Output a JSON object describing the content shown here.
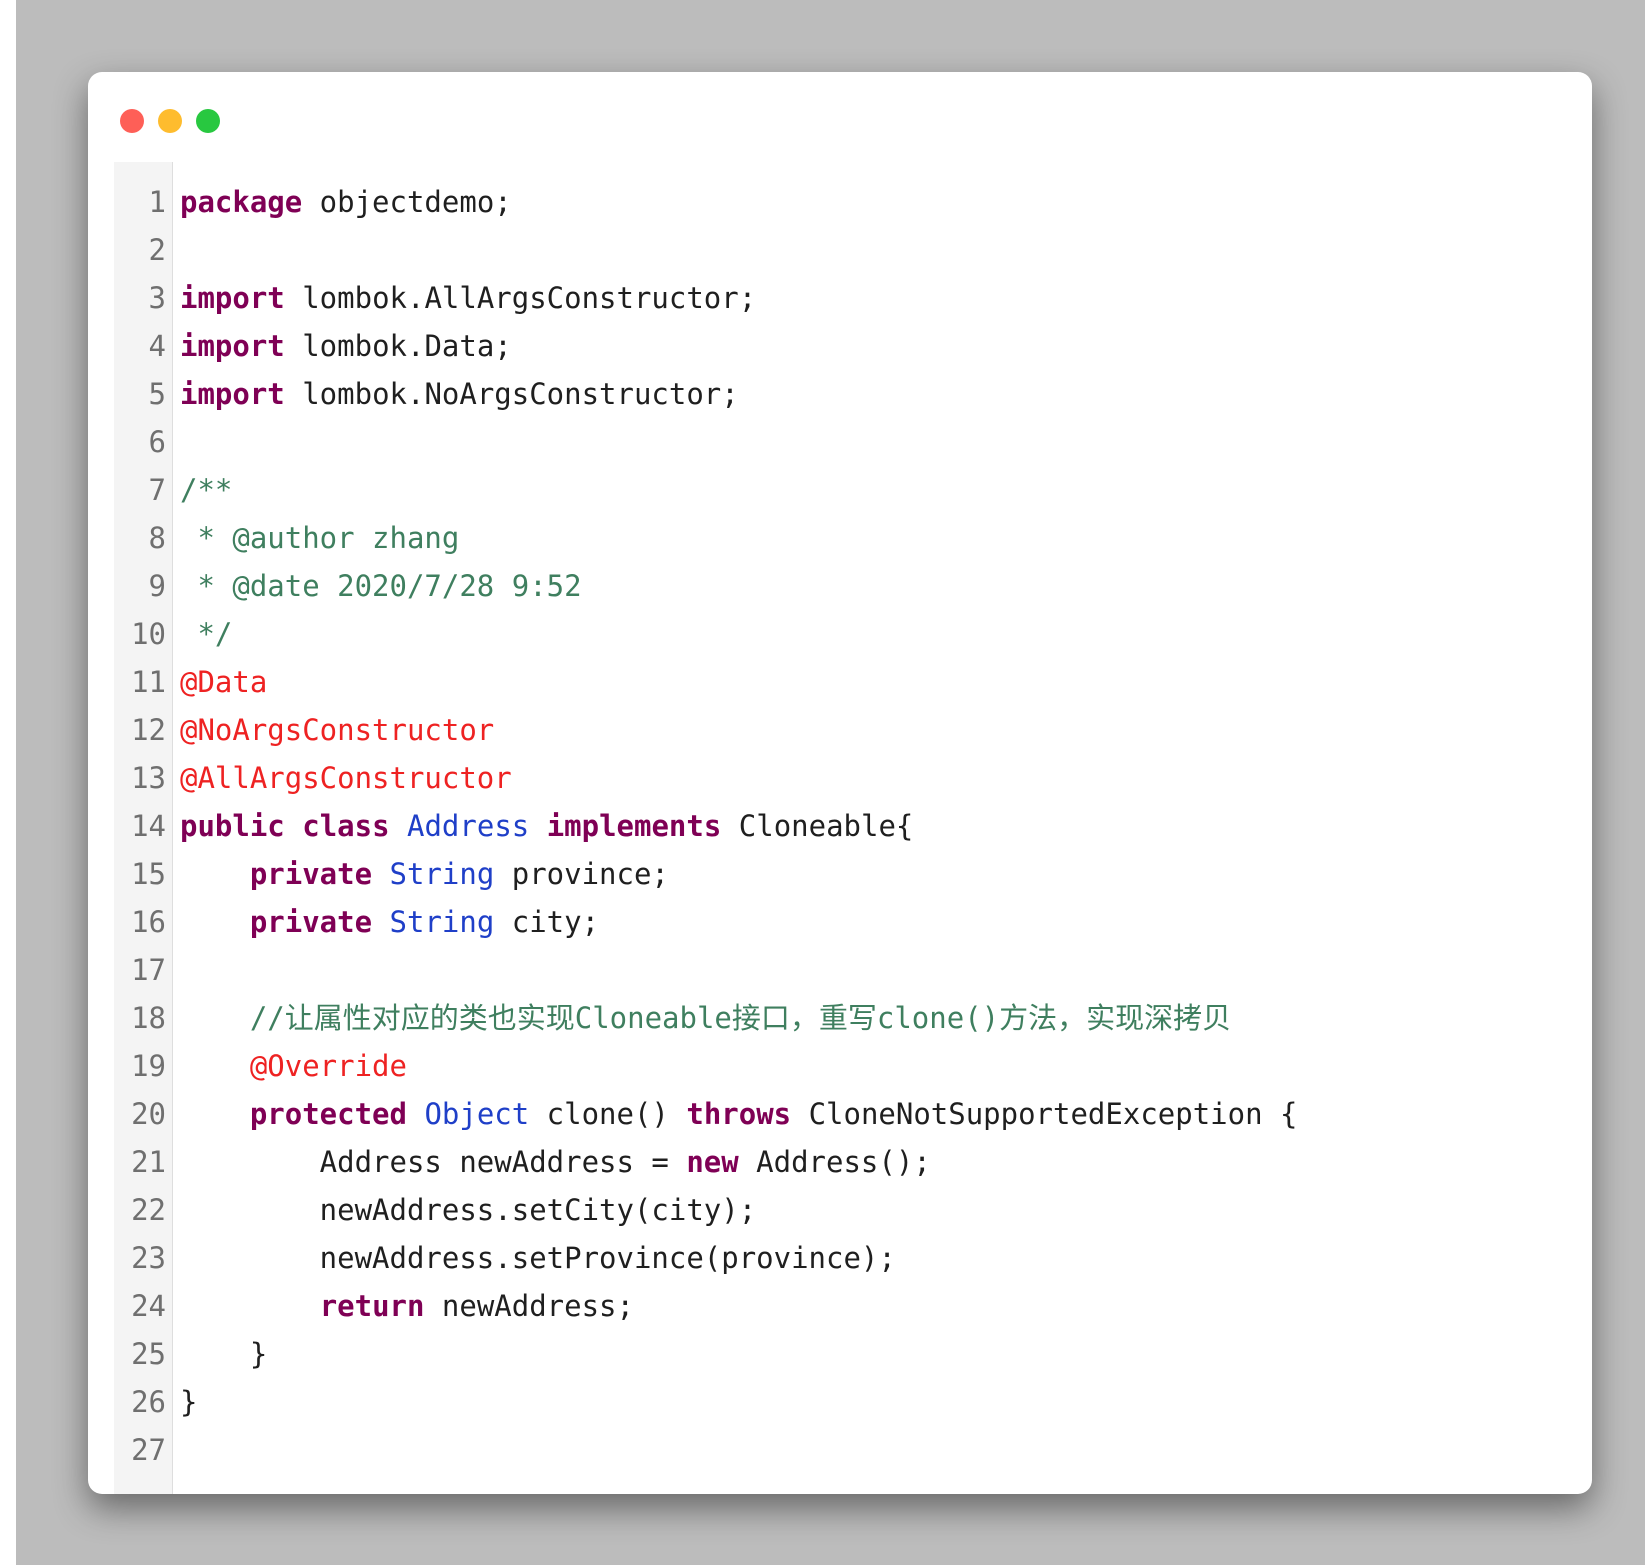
{
  "window": {
    "controls": [
      {
        "name": "close-dot",
        "color": "#fe5f57"
      },
      {
        "name": "minimize-dot",
        "color": "#febc2e"
      },
      {
        "name": "maximize-dot",
        "color": "#28c840"
      }
    ]
  },
  "editor": {
    "language": "java",
    "colors": {
      "keyword": "#7f0055",
      "type": "#1f3fc8",
      "annotation": "#ee2222",
      "comment": "#3f7f5f",
      "plain": "#1f1f1f",
      "line_number": "#6f6f6f"
    },
    "lines": [
      {
        "n": "1",
        "tokens": [
          {
            "t": "package",
            "k": "kw"
          },
          {
            "t": " objectdemo;",
            "k": "pl"
          }
        ]
      },
      {
        "n": "2",
        "tokens": []
      },
      {
        "n": "3",
        "tokens": [
          {
            "t": "import",
            "k": "kw"
          },
          {
            "t": " lombok.AllArgsConstructor;",
            "k": "pl"
          }
        ]
      },
      {
        "n": "4",
        "tokens": [
          {
            "t": "import",
            "k": "kw"
          },
          {
            "t": " lombok.Data;",
            "k": "pl"
          }
        ]
      },
      {
        "n": "5",
        "tokens": [
          {
            "t": "import",
            "k": "kw"
          },
          {
            "t": " lombok.NoArgsConstructor;",
            "k": "pl"
          }
        ]
      },
      {
        "n": "6",
        "tokens": []
      },
      {
        "n": "7",
        "tokens": [
          {
            "t": "/**",
            "k": "cm"
          }
        ]
      },
      {
        "n": "8",
        "tokens": [
          {
            "t": " * @author zhang",
            "k": "cm"
          }
        ]
      },
      {
        "n": "9",
        "tokens": [
          {
            "t": " * @date 2020/7/28 9:52",
            "k": "cm"
          }
        ]
      },
      {
        "n": "10",
        "tokens": [
          {
            "t": " */",
            "k": "cm"
          }
        ]
      },
      {
        "n": "11",
        "tokens": [
          {
            "t": "@Data",
            "k": "an"
          }
        ]
      },
      {
        "n": "12",
        "tokens": [
          {
            "t": "@NoArgsConstructor",
            "k": "an"
          }
        ]
      },
      {
        "n": "13",
        "tokens": [
          {
            "t": "@AllArgsConstructor",
            "k": "an"
          }
        ]
      },
      {
        "n": "14",
        "tokens": [
          {
            "t": "public",
            "k": "kw"
          },
          {
            "t": " ",
            "k": "pl"
          },
          {
            "t": "class",
            "k": "kw"
          },
          {
            "t": " ",
            "k": "pl"
          },
          {
            "t": "Address",
            "k": "ty"
          },
          {
            "t": " ",
            "k": "pl"
          },
          {
            "t": "implements",
            "k": "kw"
          },
          {
            "t": " Cloneable{",
            "k": "pl"
          }
        ]
      },
      {
        "n": "15",
        "tokens": [
          {
            "t": "    ",
            "k": "pl"
          },
          {
            "t": "private",
            "k": "kw"
          },
          {
            "t": " ",
            "k": "pl"
          },
          {
            "t": "String",
            "k": "ty"
          },
          {
            "t": " province;",
            "k": "pl"
          }
        ]
      },
      {
        "n": "16",
        "tokens": [
          {
            "t": "    ",
            "k": "pl"
          },
          {
            "t": "private",
            "k": "kw"
          },
          {
            "t": " ",
            "k": "pl"
          },
          {
            "t": "String",
            "k": "ty"
          },
          {
            "t": " city;",
            "k": "pl"
          }
        ]
      },
      {
        "n": "17",
        "tokens": []
      },
      {
        "n": "18",
        "tokens": [
          {
            "t": "    //让属性对应的类也实现Cloneable接口，重写clone()方法，实现深拷贝",
            "k": "cm"
          }
        ]
      },
      {
        "n": "19",
        "tokens": [
          {
            "t": "    ",
            "k": "pl"
          },
          {
            "t": "@Override",
            "k": "an"
          }
        ]
      },
      {
        "n": "20",
        "tokens": [
          {
            "t": "    ",
            "k": "pl"
          },
          {
            "t": "protected",
            "k": "kw"
          },
          {
            "t": " ",
            "k": "pl"
          },
          {
            "t": "Object",
            "k": "ty"
          },
          {
            "t": " clone() ",
            "k": "pl"
          },
          {
            "t": "throws",
            "k": "kw"
          },
          {
            "t": " CloneNotSupportedException {",
            "k": "pl"
          }
        ]
      },
      {
        "n": "21",
        "tokens": [
          {
            "t": "        Address newAddress = ",
            "k": "pl"
          },
          {
            "t": "new",
            "k": "kw"
          },
          {
            "t": " Address();",
            "k": "pl"
          }
        ]
      },
      {
        "n": "22",
        "tokens": [
          {
            "t": "        newAddress.setCity(city);",
            "k": "pl"
          }
        ]
      },
      {
        "n": "23",
        "tokens": [
          {
            "t": "        newAddress.setProvince(province);",
            "k": "pl"
          }
        ]
      },
      {
        "n": "24",
        "tokens": [
          {
            "t": "        ",
            "k": "pl"
          },
          {
            "t": "return",
            "k": "kw"
          },
          {
            "t": " newAddress;",
            "k": "pl"
          }
        ]
      },
      {
        "n": "25",
        "tokens": [
          {
            "t": "    }",
            "k": "pl"
          }
        ]
      },
      {
        "n": "26",
        "tokens": [
          {
            "t": "}",
            "k": "pl"
          }
        ]
      },
      {
        "n": "27",
        "tokens": []
      }
    ]
  }
}
